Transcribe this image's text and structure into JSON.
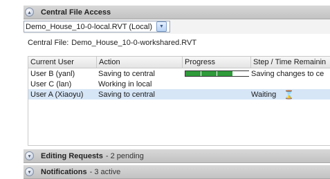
{
  "central_access": {
    "header_title": "Central File Access",
    "file_dropdown_value": "Demo_House_10-0-local.RVT (Local)",
    "central_file_label": "Central File:",
    "central_file_name": "Demo_House_10-0-workshared.RVT"
  },
  "table": {
    "columns": [
      "Current User",
      "Action",
      "Progress",
      "Step / Time Remainin"
    ],
    "rows": [
      {
        "user": "User B (yanl)",
        "action": "Saving to central",
        "progress_fraction": 0.75,
        "step": "Saving changes to ce",
        "waiting": false
      },
      {
        "user": "User C (lan)",
        "action": "Working in local",
        "progress_fraction": null,
        "step": "",
        "waiting": false
      },
      {
        "user": "User A (Xiaoyu)",
        "action": "Saving to central",
        "progress_fraction": null,
        "step": "Waiting",
        "waiting": true
      }
    ]
  },
  "editing_requests": {
    "header_title": "Editing Requests",
    "count_text": "- 2 pending"
  },
  "notifications": {
    "header_title": "Notifications",
    "count_text": "- 3 active"
  },
  "colors": {
    "progress_fill": "#2f9b3a",
    "selected_row": "#d6e6f7",
    "header_bg": "#c8c8c8"
  },
  "icons": {
    "collapse": "expand-collapse-icon",
    "dropdown": "chevron-down-icon",
    "waiting": "hourglass-icon"
  }
}
